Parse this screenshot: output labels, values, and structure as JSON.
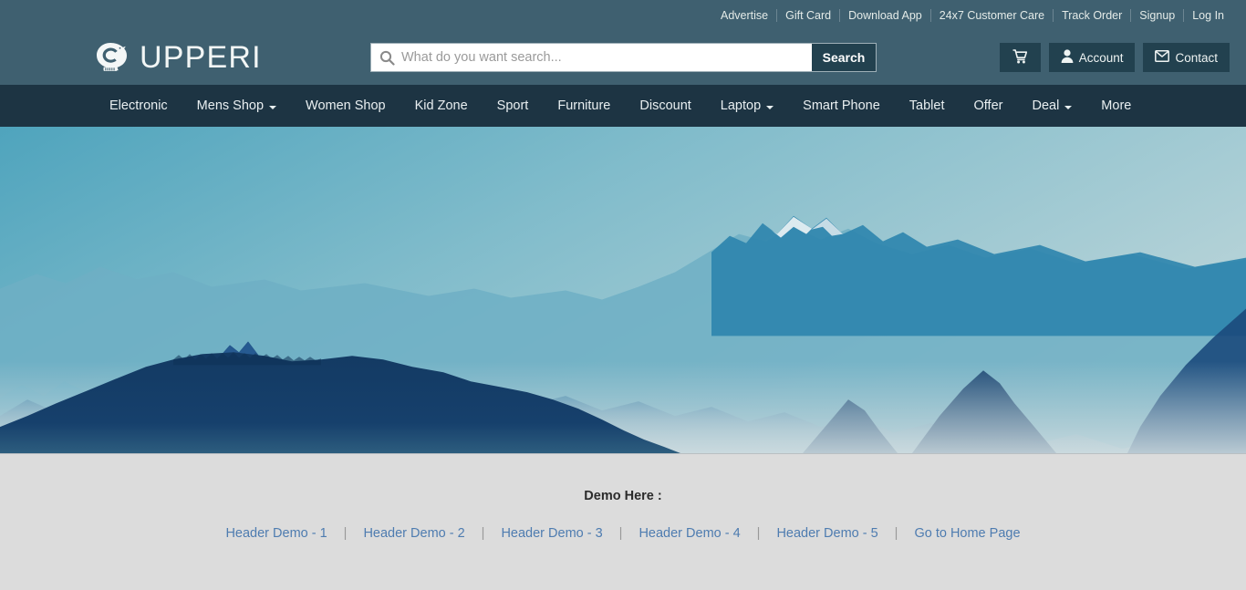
{
  "colors": {
    "header_bg": "#3f6070",
    "nav_bg": "#1d3443",
    "button_bg": "#22414f",
    "demo_bg": "#dcdcdc",
    "link_blue": "#4e7cb0",
    "sky": "#5aa8bf"
  },
  "topbar": {
    "links": [
      {
        "label": "Advertise"
      },
      {
        "label": "Gift Card"
      },
      {
        "label": "Download App"
      },
      {
        "label": "24x7 Customer Care"
      },
      {
        "label": "Track Order"
      },
      {
        "label": "Signup"
      },
      {
        "label": "Log In"
      }
    ]
  },
  "header": {
    "brand_name": "UPPERI",
    "logo_icon": "snail-logo-icon",
    "search": {
      "placeholder": "What do you want search...",
      "value": "",
      "button_label": "Search",
      "icon": "search-icon"
    },
    "actions": [
      {
        "name": "cart-button",
        "label": "",
        "icon": "cart-icon"
      },
      {
        "name": "account-button",
        "label": "Account",
        "icon": "user-icon"
      },
      {
        "name": "contact-button",
        "label": "Contact",
        "icon": "envelope-icon"
      }
    ]
  },
  "nav": {
    "items": [
      {
        "label": "Electronic",
        "has_dropdown": false
      },
      {
        "label": "Mens Shop",
        "has_dropdown": true
      },
      {
        "label": "Women Shop",
        "has_dropdown": false
      },
      {
        "label": "Kid Zone",
        "has_dropdown": false
      },
      {
        "label": "Sport",
        "has_dropdown": false
      },
      {
        "label": "Furniture",
        "has_dropdown": false
      },
      {
        "label": "Discount",
        "has_dropdown": false
      },
      {
        "label": "Laptop",
        "has_dropdown": true
      },
      {
        "label": "Smart Phone",
        "has_dropdown": false
      },
      {
        "label": "Tablet",
        "has_dropdown": false
      },
      {
        "label": "Offer",
        "has_dropdown": false
      },
      {
        "label": "Deal",
        "has_dropdown": true
      },
      {
        "label": "More",
        "has_dropdown": false
      }
    ]
  },
  "hero": {
    "alt": "Layered blue mountain range silhouettes with mist under a teal sky"
  },
  "demo": {
    "title": "Demo Here :",
    "separator": "|",
    "links": [
      {
        "label": "Header Demo - 1"
      },
      {
        "label": "Header Demo - 2"
      },
      {
        "label": "Header Demo - 3"
      },
      {
        "label": "Header Demo - 4"
      },
      {
        "label": "Header Demo - 5"
      },
      {
        "label": "Go to Home Page"
      }
    ]
  }
}
